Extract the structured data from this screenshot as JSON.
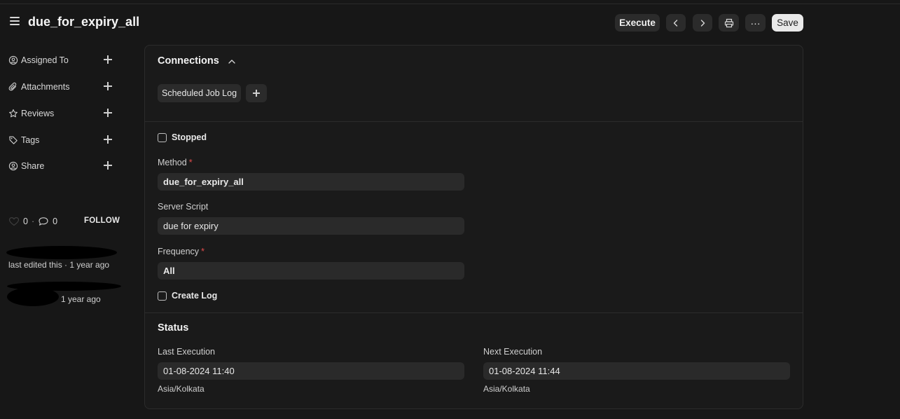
{
  "header": {
    "title": "due_for_expiry_all",
    "execute_label": "Execute",
    "more_label": "···",
    "save_label": "Save"
  },
  "sidebar": {
    "items": [
      {
        "label": "Assigned To",
        "icon": "assign-user-icon"
      },
      {
        "label": "Attachments",
        "icon": "paperclip-icon"
      },
      {
        "label": "Reviews",
        "icon": "star-icon"
      },
      {
        "label": "Tags",
        "icon": "tag-icon"
      },
      {
        "label": "Share",
        "icon": "share-user-icon"
      }
    ],
    "likes": "0",
    "dot": "·",
    "comments": "0",
    "follow_label": "FOLLOW",
    "edited_text": "last edited this · 1 year ago",
    "created_text": "1 year ago"
  },
  "connections": {
    "title": "Connections",
    "chips": [
      "Scheduled Job Log"
    ]
  },
  "form": {
    "stopped_label": "Stopped",
    "method_label": "Method",
    "method_value": "due_for_expiry_all",
    "server_script_label": "Server Script",
    "server_script_value": "due for expiry",
    "frequency_label": "Frequency",
    "frequency_value": "All",
    "create_log_label": "Create Log",
    "required_mark": "*"
  },
  "status": {
    "title": "Status",
    "last_execution_label": "Last Execution",
    "last_execution_value": "01-08-2024 11:40",
    "last_execution_tz": "Asia/Kolkata",
    "next_execution_label": "Next Execution",
    "next_execution_value": "01-08-2024 11:44",
    "next_execution_tz": "Asia/Kolkata"
  },
  "colors": {
    "background": "#171717",
    "required": "#e24c4c",
    "save_button": "#e9e9e9"
  }
}
